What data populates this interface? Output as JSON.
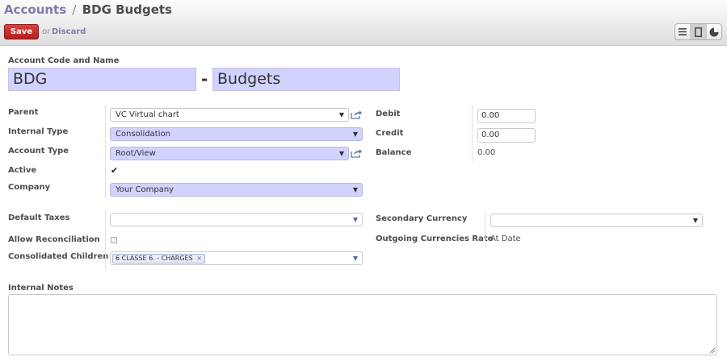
{
  "breadcrumb": {
    "parent": "Accounts",
    "separator": "/",
    "current": "BDG Budgets"
  },
  "toolbar": {
    "save_label": "Save",
    "or_label": "or",
    "discard_label": "Discard"
  },
  "view_switcher": [
    "list-icon",
    "form-icon",
    "chart-icon"
  ],
  "header": {
    "label": "Account Code and Name",
    "code": "BDG",
    "dash": "-",
    "name": "Budgets"
  },
  "left": {
    "parent_label": "Parent",
    "parent_value": "VC Virtual chart",
    "internal_type_label": "Internal Type",
    "internal_type_value": "Consolidation",
    "account_type_label": "Account Type",
    "account_type_value": "Root/View",
    "active_label": "Active",
    "active_checked": "✔",
    "company_label": "Company",
    "company_value": "Your Company",
    "default_taxes_label": "Default Taxes",
    "default_taxes_value": "",
    "allow_reconciliation_label": "Allow Reconciliation",
    "consolidated_children_label": "Consolidated Children",
    "consolidated_children_tag": "6 CLASSE 6. - CHARGES",
    "tag_remove": "×"
  },
  "right": {
    "debit_label": "Debit",
    "debit_value": "0.00",
    "credit_label": "Credit",
    "credit_value": "0.00",
    "balance_label": "Balance",
    "balance_value": "0.00",
    "secondary_currency_label": "Secondary Currency",
    "secondary_currency_value": "",
    "outgoing_rate_label": "Outgoing Currencies Rate",
    "outgoing_rate_value": "At Date"
  },
  "notes": {
    "label": "Internal Notes",
    "value": ""
  },
  "colors": {
    "accent": "#7c7bad",
    "save": "#c52a2a",
    "required_bg": "#d2d2ff"
  }
}
